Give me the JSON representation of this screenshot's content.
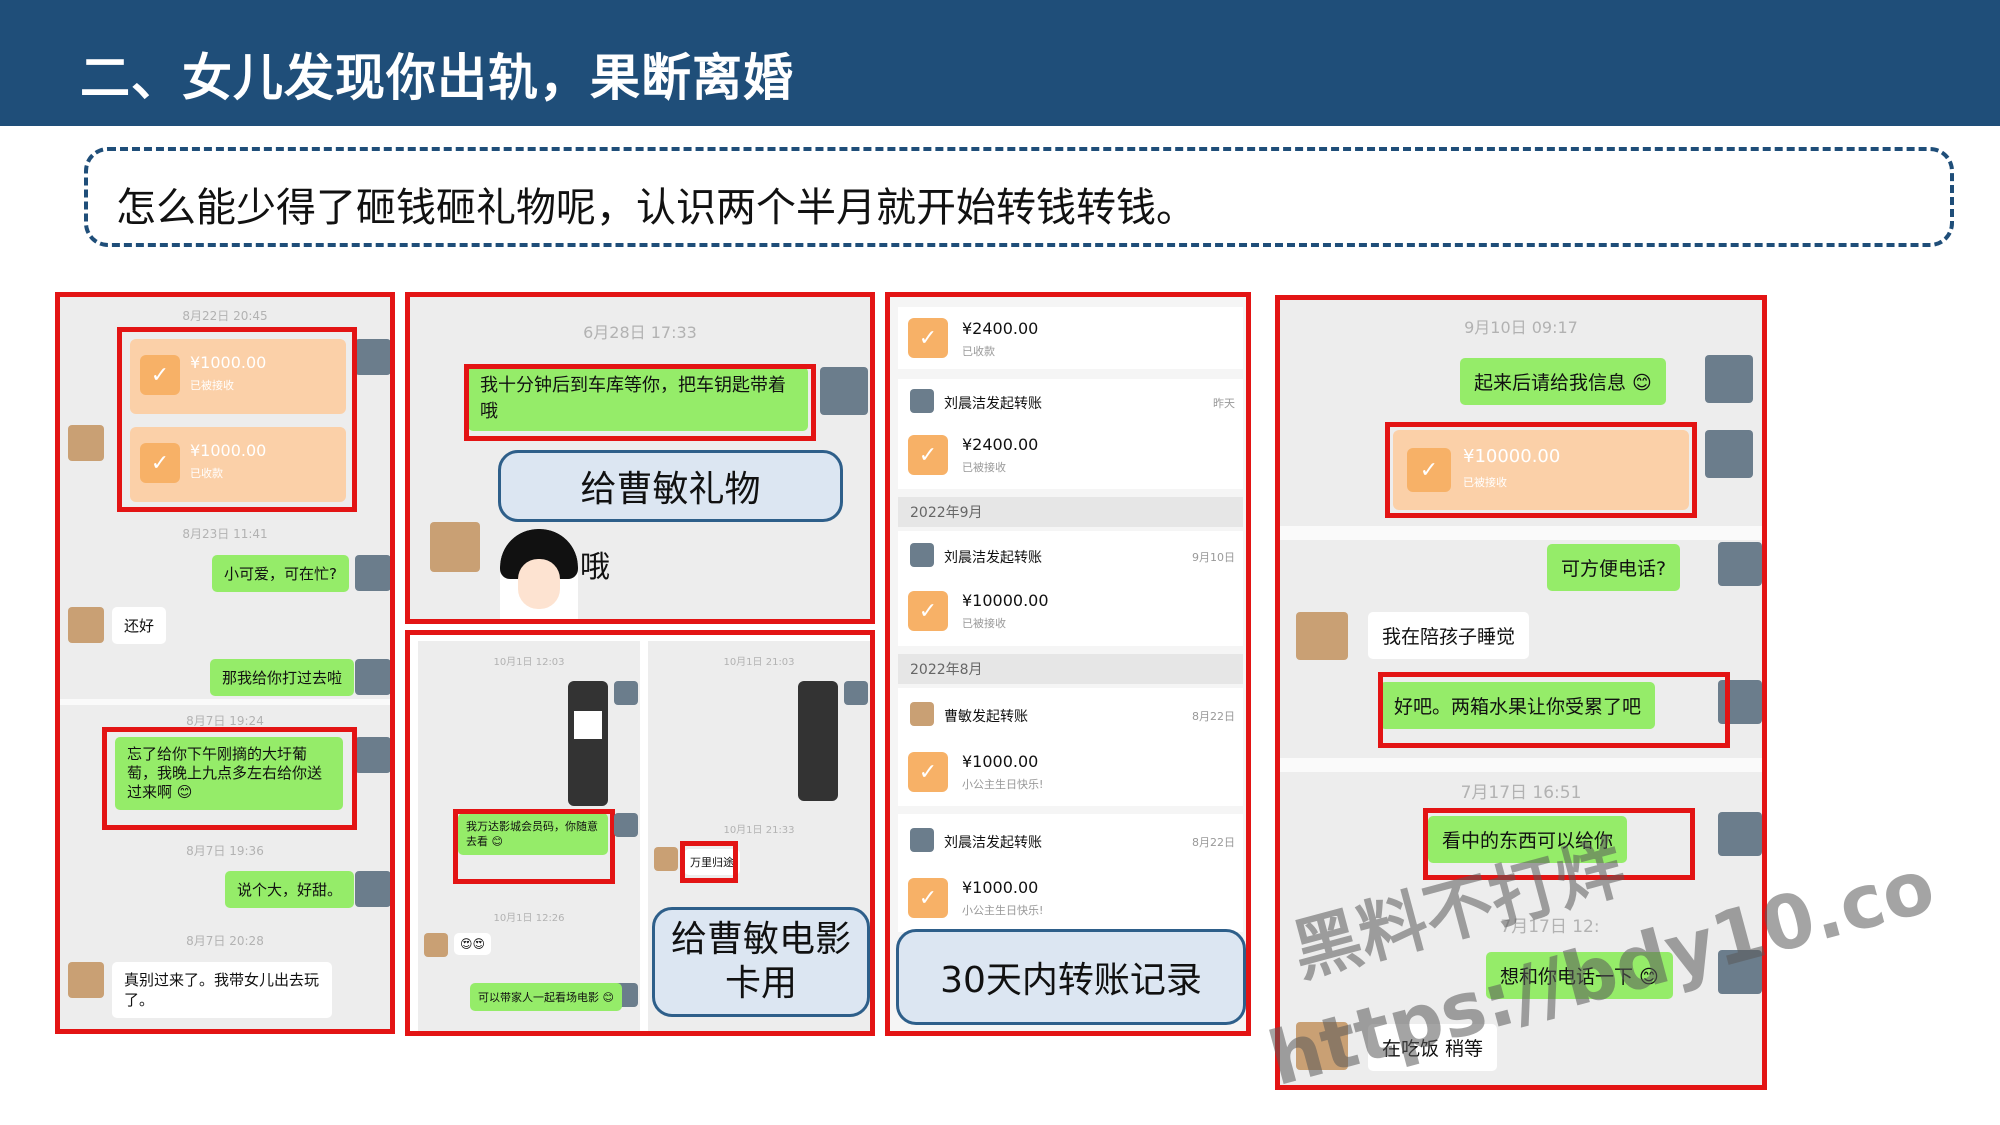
{
  "slide": {
    "title": "二、女儿发现你出轨，果断离婚",
    "subtitle": "怎么能少得了砸钱砸礼物呢，认识两个半月就开始转钱转钱。"
  },
  "panel1": {
    "ts1": "8月22日 20:45",
    "transfer1": {
      "amount": "¥1000.00",
      "status": "已被接收"
    },
    "transfer2": {
      "amount": "¥1000.00",
      "status": "已收款"
    },
    "ts2": "8月23日 11:41",
    "msg1": "小可爱，可在忙?",
    "msg2": "还好",
    "msg3": "那我给你打过去啦",
    "ts3": "8月7日 19:24",
    "msg4": "忘了给你下午刚摘的大圩葡萄，我晚上九点多左右给你送过来啊 😊",
    "ts4": "8月7日 19:36",
    "msg5": "说个大，好甜。",
    "ts5": "8月7日 20:28",
    "msg6": "真别过来了。我带女儿出去玩了。"
  },
  "panel2": {
    "ts1": "6月28日 17:33",
    "msg1": "我十分钟后到车库等你，把车钥匙带着哦",
    "callout": "给曹敏礼物",
    "sticker_text": "哦"
  },
  "panel3": {
    "left": {
      "ts1": "10月1日 12:03",
      "msg1": "我万达影城会员码，你随意去看 😊",
      "ts2": "10月1日 12:26",
      "emoji": "😍😍",
      "msg2": "可以带家人一起看场电影 😊"
    },
    "right": {
      "ts1": "10月1日 21:03",
      "ts2": "10月1日 21:33",
      "msg1": "万里归途"
    },
    "callout": "给曹敏电影卡用"
  },
  "panel4": {
    "items": [
      {
        "amount": "¥2400.00",
        "status": "已收款"
      },
      {
        "sender": "刘晨洁发起转账",
        "date": "昨天",
        "amount": "¥2400.00",
        "status": "已被接收"
      },
      {
        "month": "2022年9月"
      },
      {
        "sender": "刘晨洁发起转账",
        "date": "9月10日",
        "amount": "¥10000.00",
        "status": "已被接收"
      },
      {
        "month": "2022年8月"
      },
      {
        "sender": "曹敏发起转账",
        "date": "8月22日",
        "amount": "¥1000.00",
        "status": "小公主生日快乐!"
      },
      {
        "sender": "刘晨洁发起转账",
        "date": "8月22日",
        "amount": "¥1000.00",
        "status": "小公主生日快乐!"
      }
    ],
    "callout": "30天内转账记录"
  },
  "panel5": {
    "ts1": "9月10日 09:17",
    "msg1": "起来后请给我信息 😊",
    "transfer": {
      "amount": "¥10000.00",
      "status": "已被接收"
    },
    "msg2": "可方便电话?",
    "msg3": "我在陪孩子睡觉",
    "msg4": "好吧。两箱水果让你受累了吧",
    "ts2": "7月17日 16:51",
    "msg5": "看中的东西可以给你",
    "ts3": "7月17日 12:",
    "msg6": "想和你电话一下 😊",
    "msg7": "在吃饭 稍等"
  },
  "watermark": {
    "line1": "黑料不打烊",
    "line2": "https://bdy10.co"
  }
}
